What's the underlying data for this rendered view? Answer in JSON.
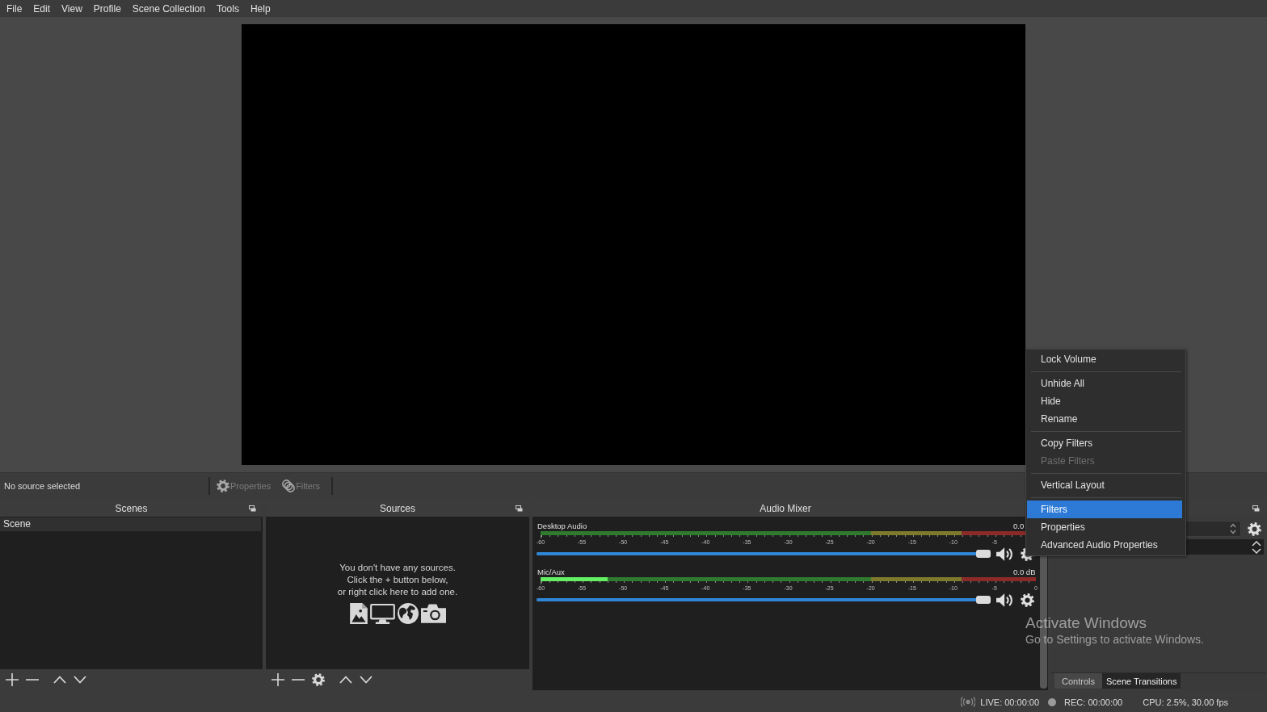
{
  "menu_bar": [
    "File",
    "Edit",
    "View",
    "Profile",
    "Scene Collection",
    "Tools",
    "Help"
  ],
  "source_toolbar": {
    "status": "No source selected",
    "buttons": [
      {
        "label": "Properties",
        "disabled": true
      },
      {
        "label": "Filters",
        "disabled": true
      }
    ]
  },
  "scenes": {
    "title": "Scenes",
    "items": [
      {
        "label": "Scene",
        "selected": true
      }
    ]
  },
  "sources": {
    "title": "Sources",
    "empty_message": "You don't have any sources.\nClick the + button below,\nor right click here to add one."
  },
  "audio_mixer": {
    "title": "Audio Mixer",
    "channels": [
      {
        "name": "Desktop Audio",
        "reading": "0.0",
        "scale": [
          "-60",
          "-55",
          "-50",
          "-45",
          "-40",
          "-35",
          "-30",
          "-25",
          "-20",
          "-15",
          "-10",
          "-5"
        ],
        "volume": {
          "level": 1
        },
        "muted": false
      },
      {
        "name": "Mic/Aux",
        "reading": "0.0 dB",
        "scale": [
          "-60",
          "-55",
          "-50",
          "-45",
          "-40",
          "-35",
          "-30",
          "-25",
          "-20",
          "-15",
          "-10",
          "-5",
          "0"
        ],
        "meter": {
          "level": 0.135
        },
        "volume": {
          "level": 1
        },
        "muted": false
      }
    ]
  },
  "transitions_dock": {
    "tabs": [
      {
        "label": "Controls",
        "selected": false
      },
      {
        "label": "Scene Transitions",
        "selected": true
      }
    ]
  },
  "context_menu": {
    "items": [
      {
        "kind": "item",
        "label": "Lock Volume",
        "selected": false,
        "disabled": false
      },
      {
        "kind": "separator"
      },
      {
        "kind": "item",
        "label": "Unhide All",
        "selected": false,
        "disabled": false
      },
      {
        "kind": "item",
        "label": "Hide",
        "selected": false,
        "disabled": false
      },
      {
        "kind": "item",
        "label": "Rename",
        "selected": false,
        "disabled": false
      },
      {
        "kind": "separator"
      },
      {
        "kind": "item",
        "label": "Copy Filters",
        "selected": false,
        "disabled": false
      },
      {
        "kind": "item",
        "label": "Paste Filters",
        "selected": false,
        "disabled": true
      },
      {
        "kind": "separator"
      },
      {
        "kind": "item",
        "label": "Vertical Layout",
        "selected": false,
        "disabled": false
      },
      {
        "kind": "separator"
      },
      {
        "kind": "item",
        "label": "Filters",
        "selected": true,
        "disabled": false
      },
      {
        "kind": "item",
        "label": "Properties",
        "selected": false,
        "disabled": false
      },
      {
        "kind": "item",
        "label": "Advanced Audio Properties",
        "selected": false,
        "disabled": false
      }
    ]
  },
  "windows_activation_notice": {
    "title": "Activate Windows",
    "text": "Go to Settings to activate Windows."
  },
  "status_bar": {
    "streaming": false,
    "live": "LIVE: 00:00:00",
    "recording": false,
    "rec": "REC: 00:00:00",
    "cpu": "CPU: 2.5%, 30.00 fps"
  }
}
